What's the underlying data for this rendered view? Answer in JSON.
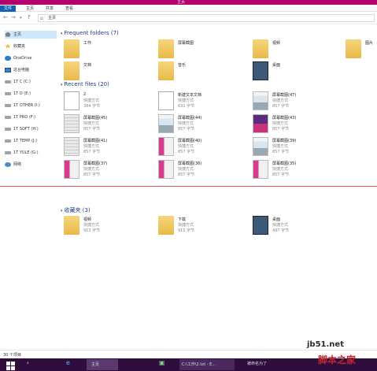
{
  "window": {
    "title": "主页"
  },
  "ribbon": {
    "tabs": [
      "文件",
      "主页",
      "共享",
      "查看"
    ]
  },
  "address": {
    "path": "主页"
  },
  "sidebar": {
    "items": [
      "主页",
      "收藏夹",
      "OneDrive",
      "这台电脑",
      "1T C (C:)",
      "1T D (E:)",
      "1T OTHER (I:)",
      "1T PRO (F:)",
      "1T SOFT (H:)",
      "1T TEMP (J:)",
      "1T YULE (G:)",
      "网络"
    ]
  },
  "frequent": {
    "header": "Frequent folders (7)",
    "items": [
      {
        "name": "工作",
        "thumb": "folder"
      },
      {
        "name": "屏幕截图",
        "thumb": "folder"
      },
      {
        "name": "视频",
        "thumb": "folder"
      },
      {
        "name": "图片",
        "thumb": "folder"
      },
      {
        "name": "文档",
        "thumb": "folder"
      },
      {
        "name": "音乐",
        "thumb": "folder"
      },
      {
        "name": "桌面",
        "thumb": "desktop"
      }
    ]
  },
  "recent": {
    "header": "Recent files (20)",
    "items": [
      {
        "name": "2",
        "sub1": "快捷方式",
        "sub2": "384 字节",
        "thumb": "doc"
      },
      {
        "name": "新建文本文档",
        "sub1": "快捷方式",
        "sub2": "631 字节",
        "thumb": "doc"
      },
      {
        "name": "屏幕截图(47)",
        "sub1": "快捷方式",
        "sub2": "857 字节",
        "thumb": "shot-a"
      },
      {
        "name": "屏幕截图(45)",
        "sub1": "快捷方式",
        "sub2": "857 字节",
        "thumb": "shot-d"
      },
      {
        "name": "屏幕截图(44)",
        "sub1": "快捷方式",
        "sub2": "857 字节",
        "thumb": "shot-a"
      },
      {
        "name": "屏幕截图(43)",
        "sub1": "快捷方式",
        "sub2": "857 字节",
        "thumb": "shot-c"
      },
      {
        "name": "屏幕截图(41)",
        "sub1": "快捷方式",
        "sub2": "857 字节",
        "thumb": "shot-d"
      },
      {
        "name": "屏幕截图(40)",
        "sub1": "快捷方式",
        "sub2": "857 字节",
        "thumb": "shot-b"
      },
      {
        "name": "屏幕截图(39)",
        "sub1": "快捷方式",
        "sub2": "857 字节",
        "thumb": "shot-a"
      },
      {
        "name": "屏幕截图(37)",
        "sub1": "快捷方式",
        "sub2": "857 字节",
        "thumb": "shot-b"
      },
      {
        "name": "屏幕截图(36)",
        "sub1": "快捷方式",
        "sub2": "857 字节",
        "thumb": "shot-b"
      },
      {
        "name": "屏幕截图(35)",
        "sub1": "快捷方式",
        "sub2": "857 字节",
        "thumb": "shot-b"
      }
    ]
  },
  "favorites": {
    "header": "收藏夹 (3)",
    "items": [
      {
        "name": "视频",
        "sub1": "快捷方式",
        "sub2": "913 字节",
        "thumb": "folder"
      },
      {
        "name": "下载",
        "sub1": "快捷方式",
        "sub2": "910 字节",
        "thumb": "folder"
      },
      {
        "name": "桌面",
        "sub1": "快捷方式",
        "sub2": "497 字节",
        "thumb": "desktop"
      }
    ]
  },
  "status": {
    "count": "30 个项目"
  },
  "taskbar": {
    "active_label": "主页",
    "label2": "C:\\工作\\2.txt - E...",
    "label3": "被命名为了"
  },
  "watermark": {
    "line1": "jb51.net",
    "line2": "脚本之家"
  },
  "colors": {
    "titlebar": "#b3006e",
    "file_tab": "#0f62b6",
    "section_header": "#1e3f87",
    "taskbar": "#2f0e3e"
  }
}
